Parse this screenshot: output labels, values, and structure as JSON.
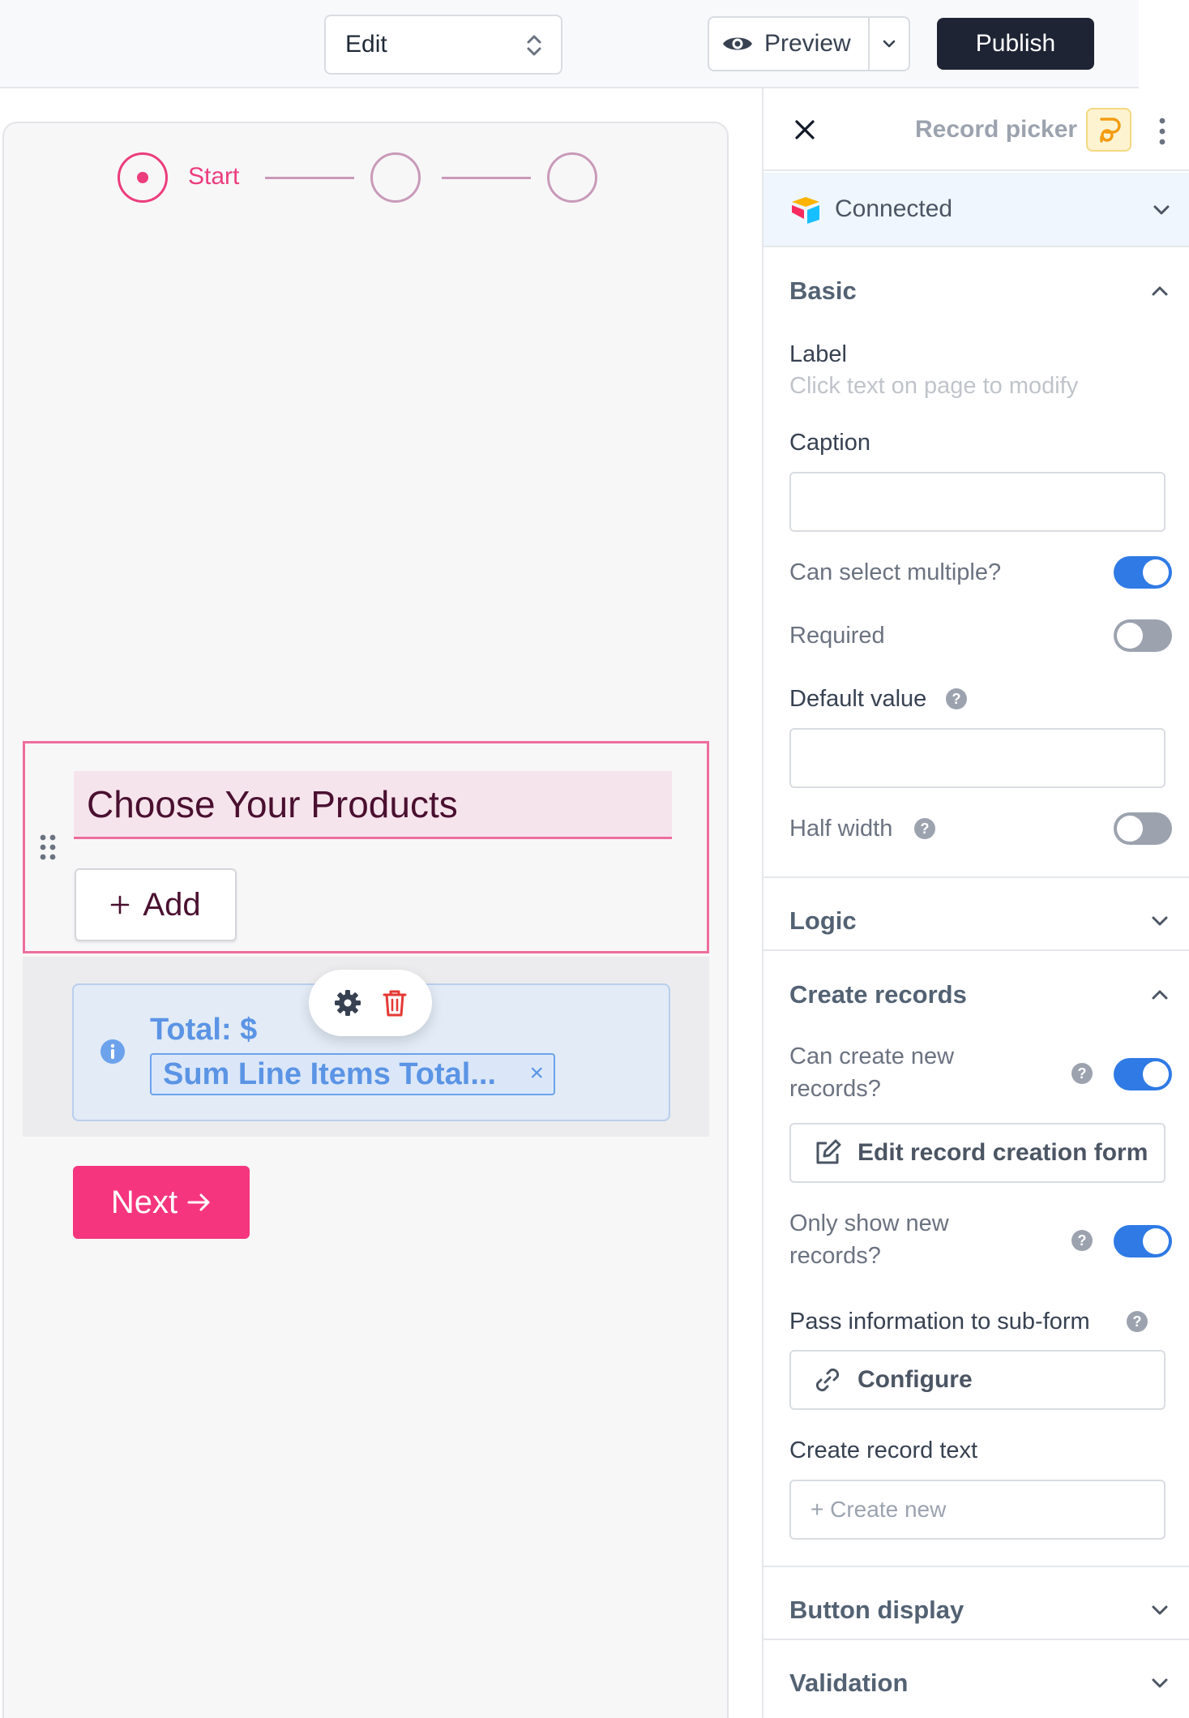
{
  "topbar": {
    "mode_value": "Edit",
    "preview_label": "Preview",
    "publish_label": "Publish"
  },
  "form": {
    "stepper": {
      "active_step_label": "Start",
      "total_steps": 3
    },
    "heading": "Choose Your Products",
    "add_label": "Add",
    "total_label": "Total: $",
    "total_chip": "Sum Line Items Total...",
    "next_label": "Next"
  },
  "panel": {
    "title": "Record picker",
    "connection": "Connected",
    "basic": {
      "heading": "Basic",
      "label_title": "Label",
      "label_hint": "Click text on page to modify",
      "caption_title": "Caption",
      "caption_value": "",
      "can_select_multiple": "Can select multiple?",
      "can_select_multiple_on": true,
      "required": "Required",
      "required_on": false,
      "default_value_title": "Default value",
      "default_value": "",
      "half_width": "Half width",
      "half_width_on": false
    },
    "logic": {
      "heading": "Logic"
    },
    "create_records": {
      "heading": "Create records",
      "can_create_line1": "Can create new",
      "can_create_line2": "records?",
      "can_create_on": true,
      "edit_form_label": "Edit record creation form",
      "only_show_line1": "Only show new",
      "only_show_line2": "records?",
      "only_show_on": true,
      "pass_info_label": "Pass information to sub-form",
      "configure_label": "Configure",
      "create_text_title": "Create record text",
      "create_text_placeholder": "+ Create new"
    },
    "button_display": {
      "heading": "Button display"
    },
    "validation": {
      "heading": "Validation"
    }
  },
  "colors": {
    "accent_pink": "#ec3d7c",
    "next_button": "#f5357e",
    "toggle_on": "#2f7ae5",
    "publish_bg": "#1e2433"
  }
}
